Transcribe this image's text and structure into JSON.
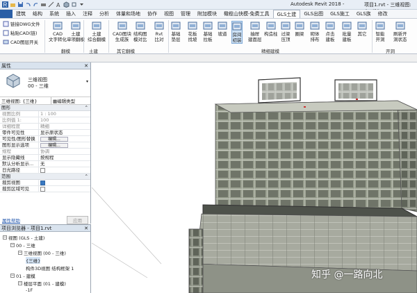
{
  "window": {
    "app_title": "Autodesk Revit 2018 -",
    "file_title": "项目1.rvt - 三维视图: {三维}"
  },
  "menu_tabs": [
    "建筑",
    "结构",
    "系统",
    "插入",
    "注释",
    "分析",
    "体量和场地",
    "协作",
    "视图",
    "管理",
    "附加模块",
    "橄榄山快模-免费工具",
    "GLS土建",
    "GLS出图",
    "GLS施工",
    "GLS族",
    "修改"
  ],
  "active_tab": "GLS土建",
  "ribbon": {
    "left_small": [
      "链接DWG文件",
      "粘贴CAD(链)",
      "CAD图层开关"
    ],
    "groups": [
      {
        "label": "翻模",
        "buttons": [
          "CAD\n文字转化",
          "土建\n单项翻模"
        ]
      },
      {
        "label": "土建",
        "buttons": [
          "土建\n综合翻模"
        ]
      },
      {
        "label": "其它翻模",
        "buttons": [
          "CAD图块\n生成族",
          "结构图\n模对比",
          "Rvt\n比对"
        ]
      },
      {
        "label": "精细建模",
        "buttons": [
          "基础\n垫层",
          "花板\n找坡",
          "基础\n拉板",
          "坡道",
          "房间\n初装",
          "抽屉\n建面层",
          "构造柱",
          "过梁\n压顶",
          "圈梁",
          "砌体\n排布",
          "点击\n建板",
          "批量\n建板",
          "其它"
        ]
      },
      {
        "label": "开洞",
        "buttons": [
          "智能\n开洞",
          "刷新开\n洞状态"
        ]
      }
    ]
  },
  "properties": {
    "title": "属性",
    "type_name": "三维视图",
    "type_sub": "00 - 三维",
    "view_selector": "三维视图: {三维}",
    "edit_type": "编辑类型",
    "groups": [
      {
        "name": "图形",
        "rows": [
          {
            "k": "视图比例",
            "v": "1 : 100",
            "dim": true
          },
          {
            "k": "比例值 1:",
            "v": "100",
            "dim": true
          },
          {
            "k": "详细程度",
            "v": "精细",
            "dim": true
          },
          {
            "k": "零件可见性",
            "v": "显示原状态",
            "dim": false
          },
          {
            "k": "可见性/图形替换",
            "v": "编辑...",
            "btn": true
          },
          {
            "k": "图形显示选项",
            "v": "编辑...",
            "btn": true
          },
          {
            "k": "规程",
            "v": "协调",
            "dim": true
          },
          {
            "k": "显示隐藏线",
            "v": "按规程",
            "dim": false
          },
          {
            "k": "默认分析显示...",
            "v": "无",
            "dim": false
          },
          {
            "k": "日光路径",
            "v": "",
            "cb": "off"
          }
        ]
      },
      {
        "name": "范围",
        "rows": [
          {
            "k": "裁剪视图",
            "v": "",
            "cb": "on"
          },
          {
            "k": "裁剪区域可见",
            "v": "",
            "cb": "off"
          }
        ]
      }
    ],
    "help_link": "属性帮助",
    "apply": "应用"
  },
  "browser": {
    "title": "项目浏览器 - 项目1.rvt",
    "items": [
      {
        "text": "视图 (GLS - 土建)",
        "level": 0,
        "tw": "−"
      },
      {
        "text": "00 - 三维",
        "level": 1,
        "tw": "−"
      },
      {
        "text": "三维视图 (00 - 三维)",
        "level": 2,
        "tw": "−"
      },
      {
        "text": "{三维}",
        "level": 3,
        "tw": "",
        "sel": true
      },
      {
        "text": "构件3D视图 结构框架 1",
        "level": 3,
        "tw": ""
      },
      {
        "text": "01 - 建模",
        "level": 1,
        "tw": "−"
      },
      {
        "text": "楼层平面 (01 - 建模)",
        "level": 2,
        "tw": "−"
      },
      {
        "text": "-1F",
        "level": 3,
        "tw": ""
      }
    ]
  },
  "watermark": "知乎 @一路向北",
  "colors": {
    "accent": "#3a79c2",
    "building": "#8a8f84",
    "ribbon_bg": "#fdfdfd"
  }
}
